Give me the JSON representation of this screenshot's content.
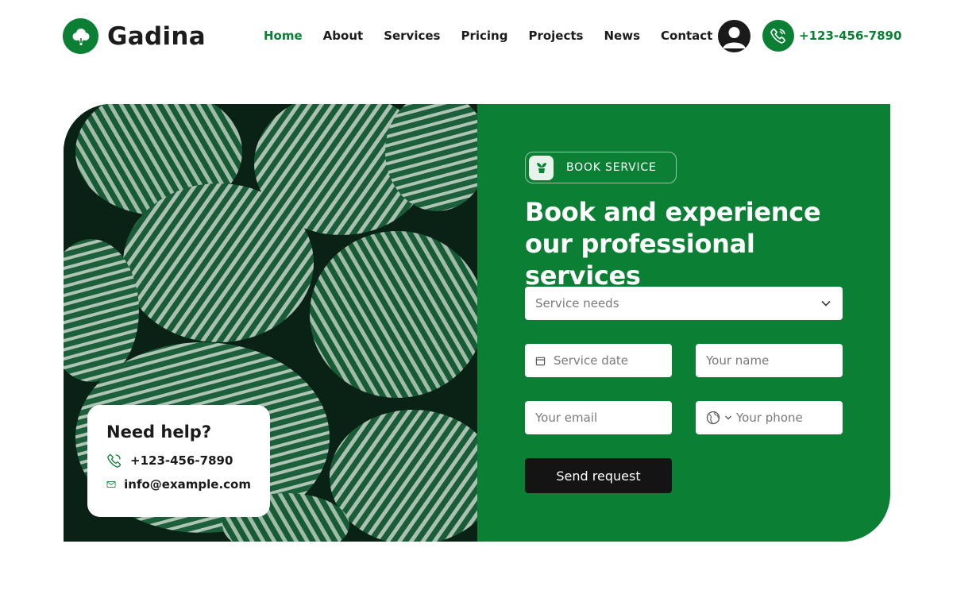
{
  "colors": {
    "brand": "#0b8035",
    "dark": "#141414",
    "white": "#ffffff"
  },
  "header": {
    "logo_text": "Gadina",
    "nav": [
      {
        "label": "Home",
        "active": true
      },
      {
        "label": "About"
      },
      {
        "label": "Services"
      },
      {
        "label": "Pricing"
      },
      {
        "label": "Projects"
      },
      {
        "label": "News"
      },
      {
        "label": "Contact"
      }
    ],
    "phone": "+123-456-7890",
    "icons": {
      "logo": "tree-icon",
      "user": "user-icon",
      "phone": "phone-icon"
    }
  },
  "hero": {
    "help": {
      "title": "Need help?",
      "phone": "+123-456-7890",
      "email": "info@example.com"
    },
    "form": {
      "badge": "BOOK SERVICE",
      "title": "Book and experience our professional services",
      "service_placeholder": "Service needs",
      "date_placeholder": "Service date",
      "name_placeholder": "Your name",
      "email_placeholder": "Your email",
      "phone_placeholder": "Your phone",
      "submit_label": "Send request"
    }
  }
}
